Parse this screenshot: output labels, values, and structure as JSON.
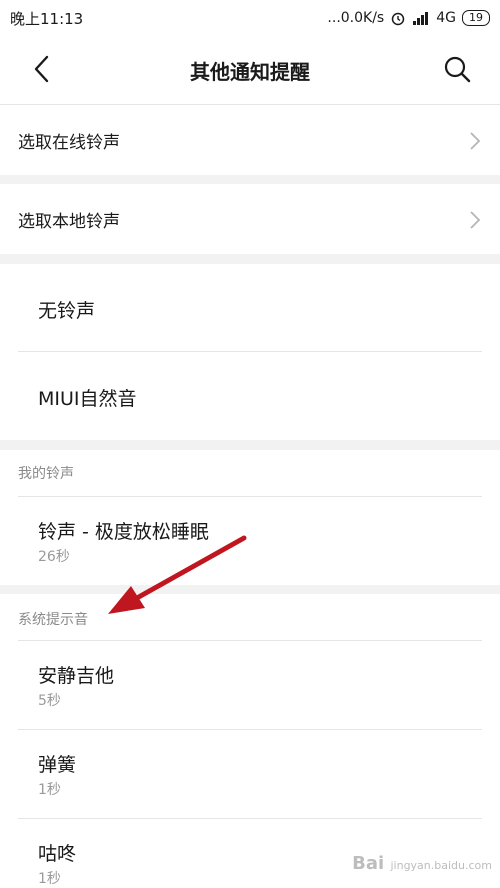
{
  "status_bar": {
    "time": "晚上11:13",
    "speed": "...0.0K/s",
    "network": "4G",
    "battery": "19"
  },
  "header": {
    "title": "其他通知提醒"
  },
  "nav_rows": [
    {
      "label": "选取在线铃声"
    },
    {
      "label": "选取本地铃声"
    }
  ],
  "basic": [
    {
      "name": "无铃声"
    },
    {
      "name": "MIUI自然音"
    }
  ],
  "my_section": {
    "title": "我的铃声",
    "items": [
      {
        "name": "铃声 - 极度放松睡眠",
        "duration": "26秒"
      }
    ]
  },
  "system_section": {
    "title": "系统提示音",
    "items": [
      {
        "name": "安静吉他",
        "duration": "5秒"
      },
      {
        "name": "弹簧",
        "duration": "1秒"
      },
      {
        "name": "咕咚",
        "duration": "1秒"
      }
    ]
  },
  "annotation": {
    "color": "#c0161f"
  },
  "watermark": {
    "brand": "Bai",
    "site": "jingyan.baidu.com"
  }
}
